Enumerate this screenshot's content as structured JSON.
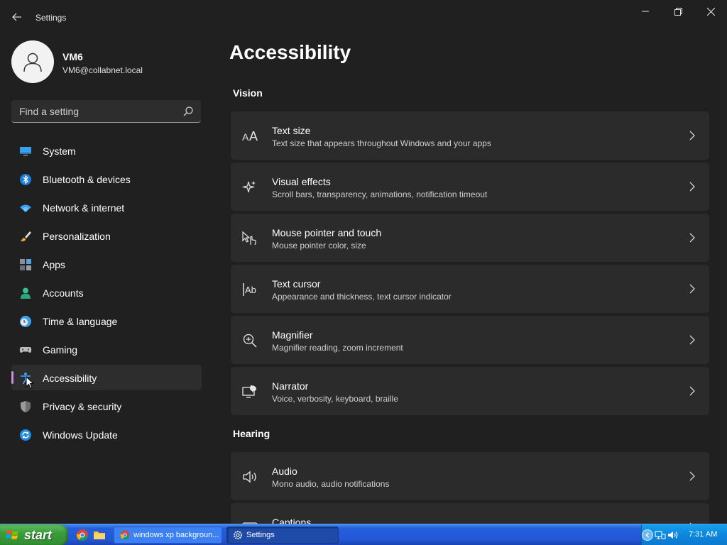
{
  "window": {
    "title": "Settings",
    "back_icon": "back-arrow-icon",
    "controls": [
      "minimize-icon",
      "restore-icon",
      "close-icon"
    ]
  },
  "profile": {
    "name": "VM6",
    "email": "VM6@collabnet.local"
  },
  "search": {
    "placeholder": "Find a setting",
    "value": ""
  },
  "sidebar": {
    "items": [
      {
        "label": "System",
        "icon": "system-icon",
        "active": false
      },
      {
        "label": "Bluetooth & devices",
        "icon": "bluetooth-icon",
        "active": false
      },
      {
        "label": "Network & internet",
        "icon": "wifi-icon",
        "active": false
      },
      {
        "label": "Personalization",
        "icon": "brush-icon",
        "active": false
      },
      {
        "label": "Apps",
        "icon": "apps-icon",
        "active": false
      },
      {
        "label": "Accounts",
        "icon": "accounts-icon",
        "active": false
      },
      {
        "label": "Time & language",
        "icon": "clock-globe-icon",
        "active": false
      },
      {
        "label": "Gaming",
        "icon": "gamepad-icon",
        "active": false
      },
      {
        "label": "Accessibility",
        "icon": "accessibility-icon",
        "active": true
      },
      {
        "label": "Privacy & security",
        "icon": "shield-icon",
        "active": false
      },
      {
        "label": "Windows Update",
        "icon": "update-icon",
        "active": false
      }
    ]
  },
  "main": {
    "title": "Accessibility",
    "sections": [
      {
        "title": "Vision",
        "items": [
          {
            "title": "Text size",
            "subtitle": "Text size that appears throughout Windows and your apps",
            "icon": "text-size-icon"
          },
          {
            "title": "Visual effects",
            "subtitle": "Scroll bars, transparency, animations, notification timeout",
            "icon": "sparkle-icon"
          },
          {
            "title": "Mouse pointer and touch",
            "subtitle": "Mouse pointer color, size",
            "icon": "pointer-touch-icon"
          },
          {
            "title": "Text cursor",
            "subtitle": "Appearance and thickness, text cursor indicator",
            "icon": "text-cursor-icon"
          },
          {
            "title": "Magnifier",
            "subtitle": "Magnifier reading, zoom increment",
            "icon": "magnifier-icon"
          },
          {
            "title": "Narrator",
            "subtitle": "Voice, verbosity, keyboard, braille",
            "icon": "narrator-icon"
          }
        ]
      },
      {
        "title": "Hearing",
        "items": [
          {
            "title": "Audio",
            "subtitle": "Mono audio, audio notifications",
            "icon": "speaker-icon"
          },
          {
            "title": "Captions",
            "subtitle": "",
            "icon": "captions-icon"
          }
        ]
      }
    ]
  },
  "taskbar": {
    "start_label": "start",
    "quick_launch": [
      "chrome-icon",
      "folder-icon"
    ],
    "tasks": [
      {
        "label": "windows xp backgroun...",
        "icon": "chrome-icon",
        "active": false
      },
      {
        "label": "Settings",
        "icon": "settings-gear-icon",
        "active": true
      }
    ],
    "tray_icons": [
      "tray-expand-icon",
      "network-tray-icon",
      "volume-tray-icon"
    ],
    "clock": "7:31 AM"
  }
}
